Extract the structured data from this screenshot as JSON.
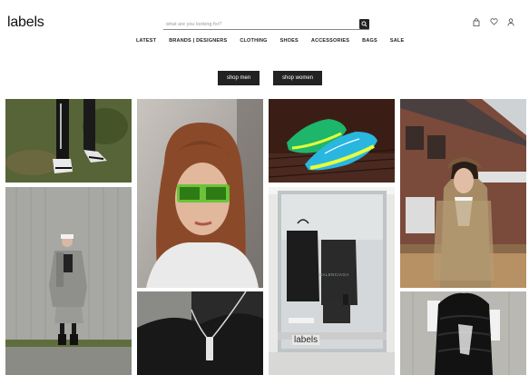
{
  "header": {
    "logo": "labels",
    "search_placeholder": "what are you looking for?",
    "icons": [
      "search-icon",
      "bag-icon",
      "heart-icon",
      "user-icon"
    ]
  },
  "nav": {
    "items": [
      "LATEST",
      "BRANDS | DESIGNERS",
      "CLOTHING",
      "SHOES",
      "ACCESSORIES",
      "BAGS",
      "SALE"
    ]
  },
  "cta": {
    "men": "shop men",
    "women": "shop women"
  },
  "gallery": {
    "storefront_sign": "labels",
    "window_text": "BALENCIAGA"
  },
  "colors": {
    "button_bg": "#222222",
    "text": "#111111"
  }
}
